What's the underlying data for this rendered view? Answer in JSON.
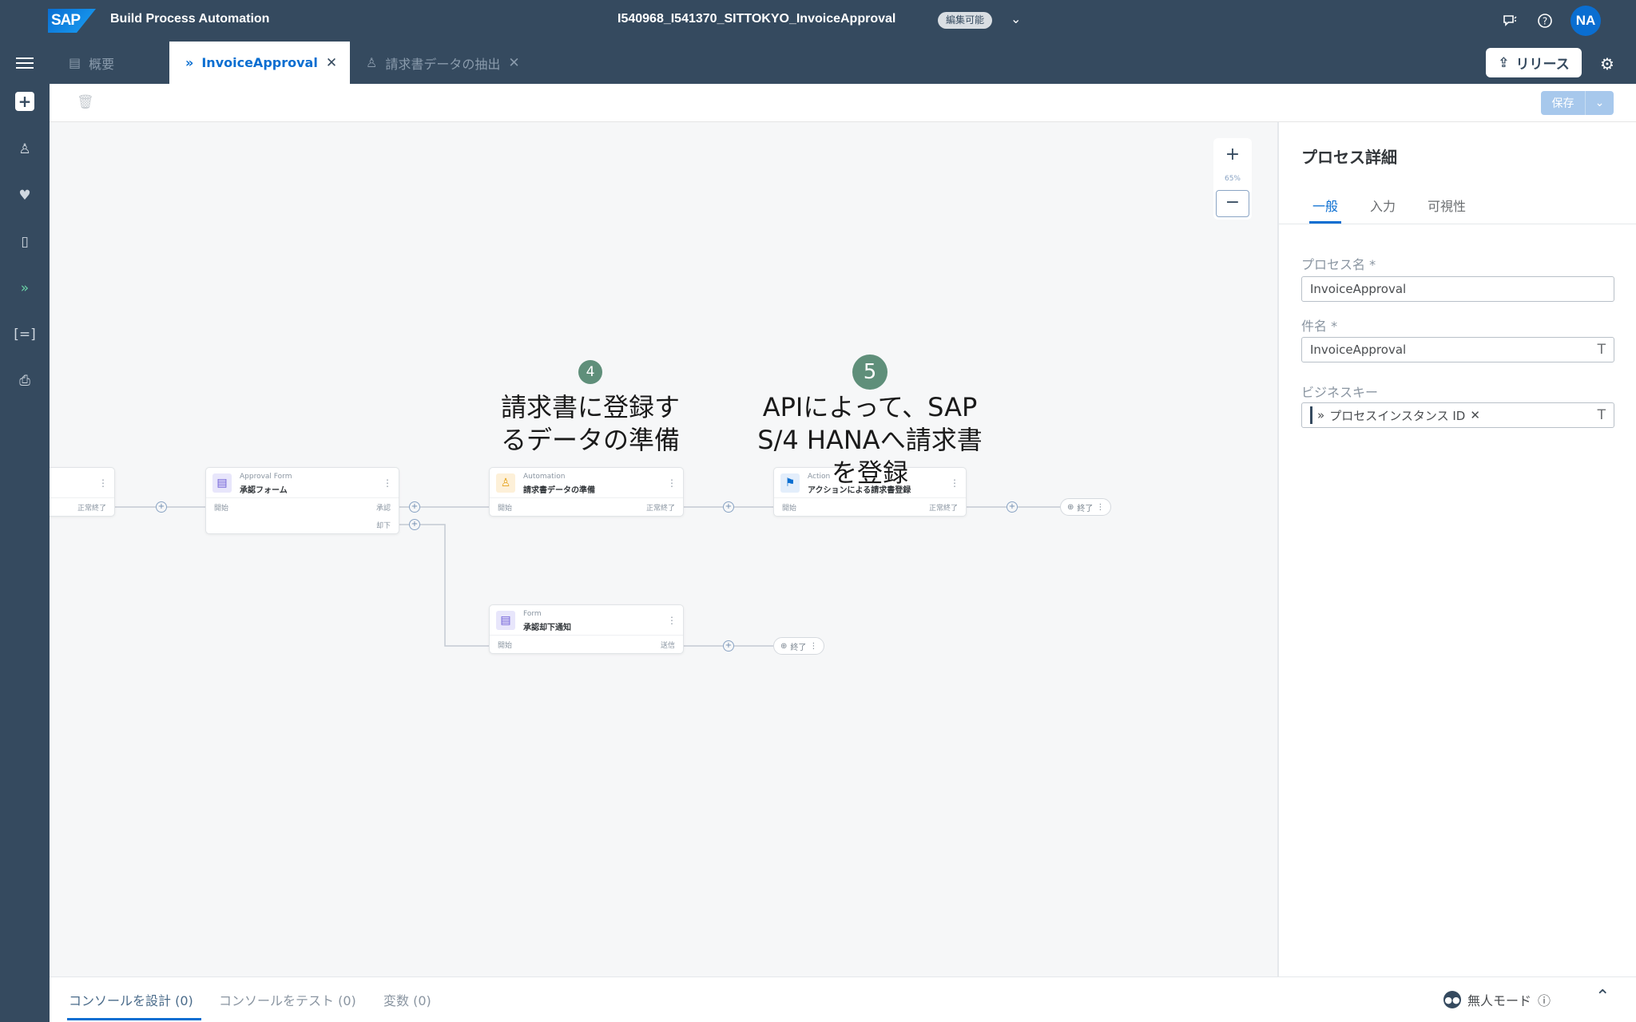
{
  "shell": {
    "logo": "SAP",
    "app_title": "Build Process Automation",
    "project_title": "I540968_I541370_SITTOKYO_InvoiceApproval",
    "mode_badge": "編集可能",
    "avatar": "NA"
  },
  "tabs": [
    {
      "label": "概要",
      "icon": "overview-icon",
      "active": false
    },
    {
      "label": "InvoiceApproval",
      "icon": "process-icon",
      "active": true
    },
    {
      "label": "請求書データの抽出",
      "icon": "automation-icon",
      "active": false
    }
  ],
  "release_button": "リリース",
  "save_button": "保存",
  "canvas": {
    "zoom_level": "65%",
    "nodes": [
      {
        "type": "",
        "name": "",
        "left_port": "",
        "right_port": "正常終了"
      },
      {
        "type": "Approval Form",
        "name": "承認フォーム",
        "left_port": "開始",
        "right_port": "承認",
        "right_port2": "却下"
      },
      {
        "type": "Automation",
        "name": "請求書データの準備",
        "left_port": "開始",
        "right_port": "正常終了"
      },
      {
        "type": "Action",
        "name": "アクションによる請求書登録",
        "left_port": "開始",
        "right_port": "正常終了"
      },
      {
        "type": "Form",
        "name": "承認却下通知",
        "left_port": "開始",
        "right_port": "送信"
      }
    ],
    "end_label": "終了"
  },
  "annotations": [
    {
      "badge": "4",
      "text_line1": "請求書に登録す",
      "text_line2": "るデータの準備"
    },
    {
      "badge": "5",
      "text_line1": "APIによって、SAP",
      "text_line2": "S/4 HANAへ請求書",
      "text_line3": "を登録"
    }
  ],
  "panel": {
    "title": "プロセス詳細",
    "tabs": [
      "一般",
      "入力",
      "可視性"
    ],
    "fields": [
      {
        "label": "プロセス名 *",
        "value": "InvoiceApproval"
      },
      {
        "label": "件名 *",
        "value": "InvoiceApproval"
      },
      {
        "label": "ビジネスキー",
        "token": "プロセスインスタンス ID"
      }
    ]
  },
  "bottom": {
    "tabs": [
      "コンソールを設計 (0)",
      "コンソールをテスト (0)",
      "変数 (0)"
    ],
    "unattended_mode": "無人モード"
  },
  "colors": {
    "shell": "#354a5f",
    "accent": "#0a6ed1",
    "annotation_badge": "#5f8f7a"
  }
}
